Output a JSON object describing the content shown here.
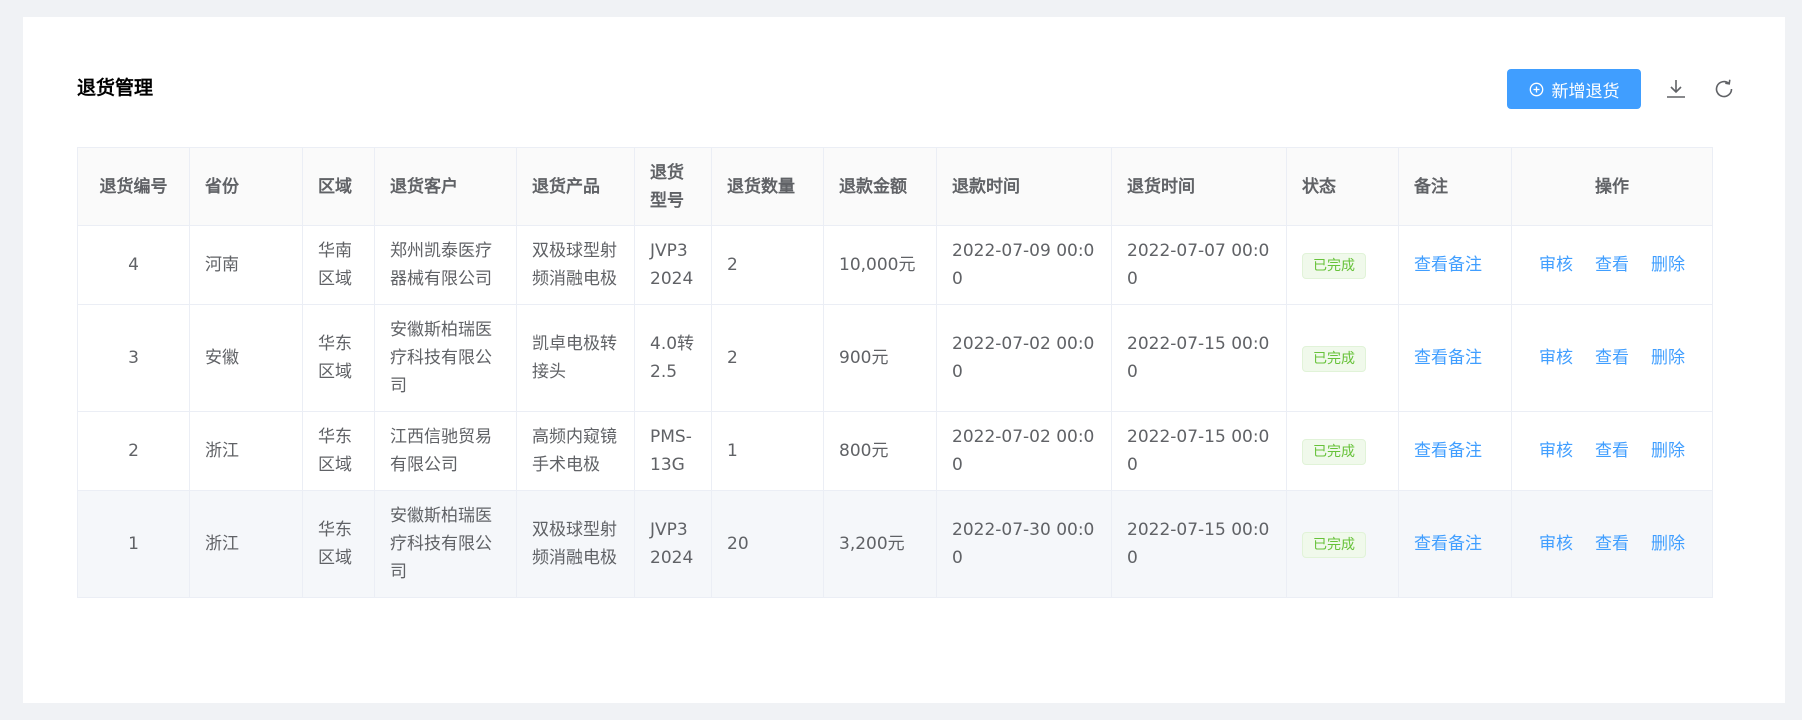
{
  "header": {
    "title": "退货管理",
    "add_label": "新增退货",
    "add_icon": "plus-circle-icon",
    "download_icon": "download-icon",
    "refresh_icon": "refresh-icon"
  },
  "table": {
    "columns": [
      "退货编号",
      "省份",
      "区域",
      "退货客户",
      "退货产品",
      "退货型号",
      "退货数量",
      "退款金额",
      "退款时间",
      "退货时间",
      "状态",
      "备注",
      "操作"
    ],
    "rows": [
      {
        "id": "4",
        "province": "河南",
        "region": "华南区域",
        "customer": "郑州凯泰医疗器械有限公司",
        "product": "双极球型射频消融电极",
        "model": "JVP3 2024",
        "quantity": "2",
        "amount": "10,000元",
        "refund_time": "2022-07-09 00:00",
        "return_time": "2022-07-07 00:00",
        "status": "已完成",
        "note": "查看备注",
        "actions": [
          "审核",
          "查看",
          "删除"
        ]
      },
      {
        "id": "3",
        "province": "安徽",
        "region": "华东区域",
        "customer": "安徽斯柏瑞医疗科技有限公司",
        "product": "凯卓电极转接头",
        "model": "4.0转 2.5",
        "quantity": "2",
        "amount": "900元",
        "refund_time": "2022-07-02 00:00",
        "return_time": "2022-07-15 00:00",
        "status": "已完成",
        "note": "查看备注",
        "actions": [
          "审核",
          "查看",
          "删除"
        ]
      },
      {
        "id": "2",
        "province": "浙江",
        "region": "华东区域",
        "customer": "江西信驰贸易有限公司",
        "product": "高频内窥镜手术电极",
        "model": "PMS-13G",
        "quantity": "1",
        "amount": "800元",
        "refund_time": "2022-07-02 00:00",
        "return_time": "2022-07-15 00:00",
        "status": "已完成",
        "note": "查看备注",
        "actions": [
          "审核",
          "查看",
          "删除"
        ]
      },
      {
        "id": "1",
        "province": "浙江",
        "region": "华东区域",
        "customer": "安徽斯柏瑞医疗科技有限公司",
        "product": "双极球型射频消融电极",
        "model": "JVP3 2024",
        "quantity": "20",
        "amount": "3,200元",
        "refund_time": "2022-07-30 00:00",
        "return_time": "2022-07-15 00:00",
        "status": "已完成",
        "note": "查看备注",
        "actions": [
          "审核",
          "查看",
          "删除"
        ]
      }
    ]
  },
  "colors": {
    "primary": "#409eff",
    "success_text": "#67c23a",
    "success_bg": "#f0f9eb",
    "page_bg": "#f0f2f5"
  }
}
